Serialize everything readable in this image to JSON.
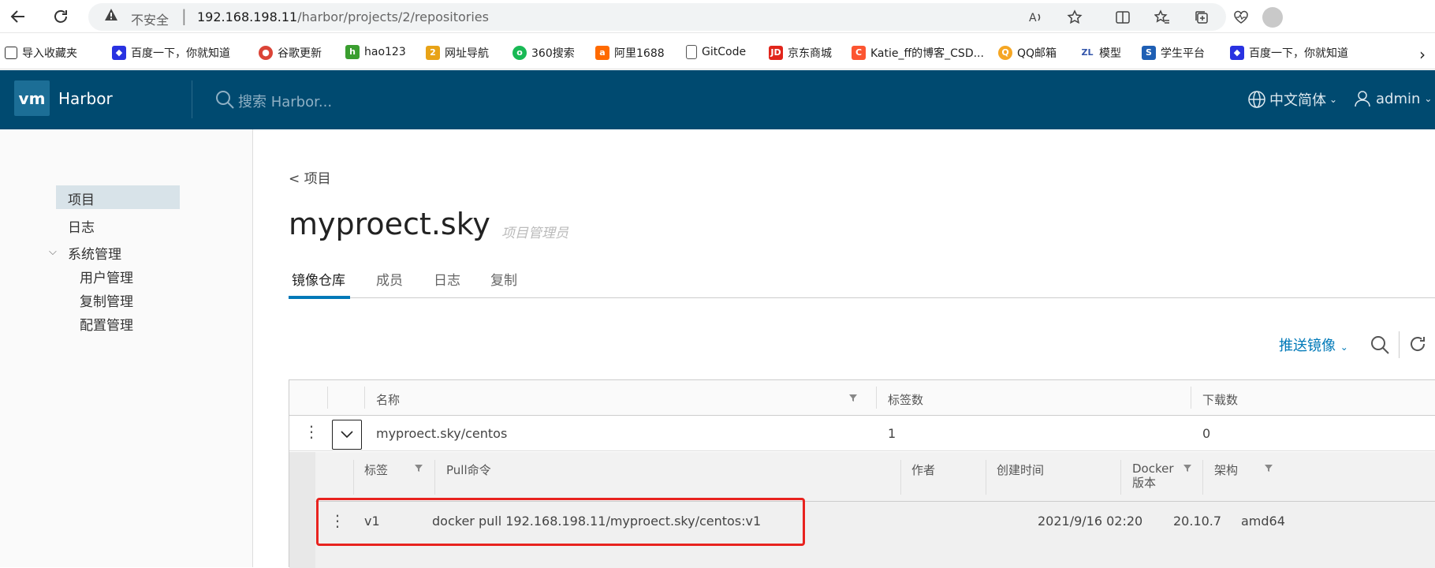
{
  "browser": {
    "url_insecure_label": "不安全",
    "url_separator": "|",
    "url_host": "192.168.198.11",
    "url_path": "/harbor/projects/2/repositories"
  },
  "bookmarks": [
    {
      "label": "导入收藏夹",
      "icon": "import-icon",
      "color": "#333333"
    },
    {
      "label": "百度一下，你就知道",
      "icon": "baidu-icon",
      "color": "#2932e1"
    },
    {
      "label": "谷歌更新",
      "icon": "chrome-icon",
      "color": "#db4437"
    },
    {
      "label": "hao123",
      "icon": "hao123-icon",
      "color": "#3a9e2f"
    },
    {
      "label": "网址导航",
      "icon": "2345-icon",
      "color": "#e8a317"
    },
    {
      "label": "360搜索",
      "icon": "360-icon",
      "color": "#19b955"
    },
    {
      "label": "阿里1688",
      "icon": "1688-icon",
      "color": "#ff6a00"
    },
    {
      "label": "GitCode",
      "icon": "file-icon",
      "color": "#666666"
    },
    {
      "label": "京东商城",
      "icon": "jd-icon",
      "color": "#e1251b"
    },
    {
      "label": "Katie_ff的博客_CSD...",
      "icon": "csdn-icon",
      "color": "#fc5531"
    },
    {
      "label": "QQ邮箱",
      "icon": "qqmail-icon",
      "color": "#f5a623"
    },
    {
      "label": "模型",
      "icon": "zl-icon",
      "color": "#3355aa"
    },
    {
      "label": "学生平台",
      "icon": "student-icon",
      "color": "#1e5fb4"
    },
    {
      "label": "百度一下，你就知道",
      "icon": "baidu-icon",
      "color": "#2932e1"
    }
  ],
  "header": {
    "logo_text": "vm",
    "brand": "Harbor",
    "search_placeholder": "搜索 Harbor...",
    "language": "中文简体",
    "user": "admin"
  },
  "sidebar": {
    "items": [
      {
        "label": "项目",
        "active": true
      },
      {
        "label": "日志"
      },
      {
        "label": "系统管理",
        "expanded": true
      },
      {
        "label": "用户管理"
      },
      {
        "label": "复制管理"
      },
      {
        "label": "配置管理"
      }
    ]
  },
  "main": {
    "back_link": "< 项目",
    "project_name": "myproect.sky",
    "project_role": "项目管理员",
    "tabs": [
      {
        "label": "镜像仓库",
        "active": true
      },
      {
        "label": "成员"
      },
      {
        "label": "日志"
      },
      {
        "label": "复制"
      }
    ],
    "push_button": "推送镜像",
    "repo_columns": [
      "名称",
      "标签数",
      "下载数"
    ],
    "repo_rows": [
      {
        "name": "myproect.sky/centos",
        "tags": "1",
        "pulls": "0"
      }
    ],
    "tag_columns": [
      "标签",
      "Pull命令",
      "作者",
      "创建时间",
      "Docker 版本",
      "架构"
    ],
    "tag_rows": [
      {
        "tag": "v1",
        "pull_command": "docker pull 192.168.198.11/myproect.sky/centos:v1",
        "author": "",
        "created": "2021/9/16 02:20",
        "docker_version": "20.10.7",
        "arch": "amd64"
      }
    ]
  },
  "colors": {
    "header_bg": "#004a70",
    "accent": "#0079b8",
    "highlight_box": "#e8231f"
  }
}
